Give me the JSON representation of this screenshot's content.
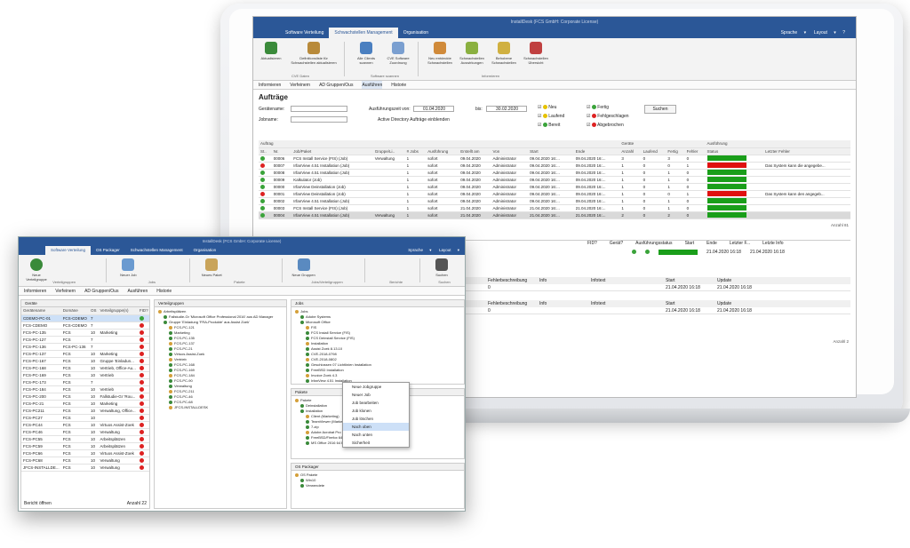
{
  "laptop": {
    "title": "InstallDesk (FCS GmbH: Corporate License)",
    "tabs": [
      "Software Verteilung",
      "Schwachstellen Management",
      "Organisation"
    ],
    "active_tab": "Schwachstellen Management",
    "menu_right": [
      "Sprache",
      "Layout"
    ],
    "ribbon": [
      {
        "label": "Aktualisieren"
      },
      {
        "label": "Definitionsliste für Schwachstellen aktualisieren"
      },
      {
        "label": "Alle Clients scannen"
      },
      {
        "label": "CVE Software Zuordnung"
      },
      {
        "label": "Neu entdeckte Schwachstellen"
      },
      {
        "label": "Schwachstellen Auswirkungen"
      },
      {
        "label": "Behobene Schwachstellen"
      },
      {
        "label": "Schwachstellen Übersicht"
      }
    ],
    "ribbon_groups": [
      "CVE Daten",
      "Software scannen",
      "Informieren"
    ],
    "nav_tabs": [
      "Informieren",
      "Verfeinern",
      "AD Gruppen/Ous",
      "Ausführen",
      "Historie"
    ],
    "section": "Aufträge",
    "filters": {
      "ger_label": "Gerätename:",
      "job_label": "Jobname:",
      "date_label": "Ausführungszeit von:",
      "date_from": "01.04.2020",
      "bis": "bis:",
      "date_to": "30.02.2020",
      "ad": "Active Directory Aufträge einblenden",
      "search": "Suchen"
    },
    "status_checks": [
      "Neu",
      "Laufend",
      "Bereit",
      "Fertig",
      "Fehlgeschlagen",
      "Abgebrochen"
    ],
    "group_headers": [
      "Auftrag",
      "Geräte",
      "Ausführung"
    ],
    "columns": [
      "St..",
      "Nr.",
      "Job/Paket",
      "Gruppe/Li..",
      "# Jobs",
      "Ausführung",
      "Erstellt am",
      "Von",
      "Start",
      "Ende",
      "Anzahl",
      "Laufend",
      "Fertig",
      "Fehler",
      "Status",
      "Letzter Fehler"
    ],
    "rows": [
      {
        "st": "ok",
        "nr": "00006",
        "job": "FCS Install Service (FIS) (Job)",
        "grp": "Verwaltung",
        "n": "1",
        "ex": "sofort",
        "cr": "09.04.2020",
        "von": "Administrator",
        "start": "09.04.2020 16:...",
        "end": "09.04.2020 16:...",
        "cnt": "3",
        "run": "0",
        "done": "3",
        "fail": "0",
        "bar": "g",
        "err": ""
      },
      {
        "st": "err",
        "nr": "00007",
        "job": "IrfanView 4.51 Installation (Job)",
        "grp": "",
        "n": "1",
        "ex": "sofort",
        "cr": "09.04.2020",
        "von": "Administrator",
        "start": "09.04.2020 16:...",
        "end": "09.04.2020 16:...",
        "cnt": "1",
        "run": "0",
        "done": "0",
        "fail": "1",
        "bar": "r",
        "err": "Das System kann die angegebe..."
      },
      {
        "st": "ok",
        "nr": "00008",
        "job": "IrfanView 4.51 Installation (Job)",
        "grp": "",
        "n": "1",
        "ex": "sofort",
        "cr": "09.04.2020",
        "von": "Administrator",
        "start": "09.04.2020 16:...",
        "end": "09.04.2020 16:...",
        "cnt": "1",
        "run": "0",
        "done": "1",
        "fail": "0",
        "bar": "g",
        "err": ""
      },
      {
        "st": "ok",
        "nr": "00009",
        "job": "Kalkulator (Job)",
        "grp": "",
        "n": "1",
        "ex": "sofort",
        "cr": "09.04.2020",
        "von": "Administrator",
        "start": "09.04.2020 16:...",
        "end": "09.04.2020 16:...",
        "cnt": "1",
        "run": "0",
        "done": "1",
        "fail": "0",
        "bar": "g",
        "err": ""
      },
      {
        "st": "ok",
        "nr": "00000",
        "job": "IrfanView Deinstallation (Job)",
        "grp": "",
        "n": "1",
        "ex": "sofort",
        "cr": "09.04.2020",
        "von": "Administrator",
        "start": "09.04.2020 16:...",
        "end": "09.04.2020 16:...",
        "cnt": "1",
        "run": "0",
        "done": "1",
        "fail": "0",
        "bar": "g",
        "err": ""
      },
      {
        "st": "err",
        "nr": "00001",
        "job": "IrfanView Deinstallation (Job)",
        "grp": "",
        "n": "1",
        "ex": "sofort",
        "cr": "09.04.2020",
        "von": "Administrator",
        "start": "09.04.2020 16:...",
        "end": "09.04.2020 16:...",
        "cnt": "1",
        "run": "0",
        "done": "0",
        "fail": "1",
        "bar": "r",
        "err": "Das System kann den angegeb..."
      },
      {
        "st": "ok",
        "nr": "00002",
        "job": "IrfanView 4.51 Installation (Job)",
        "grp": "",
        "n": "1",
        "ex": "sofort",
        "cr": "09.04.2020",
        "von": "Administrator",
        "start": "09.04.2020 16:...",
        "end": "09.04.2020 16:...",
        "cnt": "1",
        "run": "0",
        "done": "1",
        "fail": "0",
        "bar": "g",
        "err": ""
      },
      {
        "st": "ok",
        "nr": "00003",
        "job": "FCS Install Service (FIS) (Job)",
        "grp": "",
        "n": "1",
        "ex": "sofort",
        "cr": "21.04.2020",
        "von": "Administrator",
        "start": "21.04.2020 16:...",
        "end": "21.04.2020 16:...",
        "cnt": "1",
        "run": "0",
        "done": "1",
        "fail": "0",
        "bar": "g",
        "err": ""
      },
      {
        "st": "ok",
        "nr": "00004",
        "job": "IrfanView 4.51 Installation (Job)",
        "grp": "Verwaltung",
        "n": "1",
        "ex": "sofort",
        "cr": "21.04.2020",
        "von": "Administrator",
        "start": "21.04.2020 16:...",
        "end": "21.04.2020 16:...",
        "cnt": "2",
        "run": "0",
        "done": "2",
        "fail": "0",
        "bar": "g",
        "err": ""
      }
    ],
    "count1": "Anzahl 81",
    "count2": "Anzahl 2",
    "detail_cols": [
      "FID?",
      "Gerät?",
      "Ausführungsstatus",
      "Start",
      "Ende",
      "Letzter F...",
      "Letzte Info"
    ],
    "detail_row": {
      "start": "21.04.2020 16:18",
      "end": "21.04.2020 16:18"
    },
    "sub_cols": [
      "Fehler",
      "Fehlerbeschreibung",
      "Info",
      "Infotext",
      "Start",
      "Update"
    ],
    "sub_rows": [
      {
        "status": "Fertig",
        "fehler": "0",
        "start": "21.04.2020 16:18",
        "update": "21.04.2020 16:18"
      },
      {
        "status": "Fertig",
        "fehler": "0",
        "start": "21.04.2020 16:18",
        "update": "21.04.2020 16:18"
      }
    ]
  },
  "win2": {
    "title": "InstallDesk (FCS GmbH: Corporate License)",
    "tabs": [
      "Software Verteilung",
      "OS Packager",
      "Schwachstellen Management",
      "Organisation"
    ],
    "active_tab": "Software Verteilung",
    "menu_right": [
      "Sprache",
      "Layout"
    ],
    "ribbon_groups": [
      "Verteilgruppen",
      "Jobs",
      "Pakete",
      "Jobs/Verteilgruppen",
      "Berichte",
      "Suchen"
    ],
    "ribbon_btns": [
      "Neue Verteilgruppe",
      "Neuer Job",
      "Neues Paket",
      "Neue Gruppen",
      "Suchen"
    ],
    "nav_tabs": [
      "Informieren",
      "Verfeinern",
      "AD Gruppen/Ous",
      "Ausführen",
      "Historie"
    ],
    "panels": {
      "devices": "Geräte",
      "groups": "Verteilgruppen",
      "jobs": "Jobs",
      "packages": "Pakete",
      "os": "OS Packager"
    },
    "dev_cols": [
      "Gerätename",
      "Domäne",
      "OS",
      "Verteilgruppe(n)",
      "FID?"
    ],
    "devices": [
      {
        "n": "CDEMO-PC-01",
        "d": "FCS-CDEMO",
        "os": "7",
        "g": "",
        "s": "ok"
      },
      {
        "n": "FCS-CDEMO",
        "d": "FCS-CDEMO",
        "os": "7",
        "g": "",
        "s": "err"
      },
      {
        "n": "FCS-PC-135",
        "d": "FCS",
        "os": "10",
        "g": "Marketing",
        "s": "err"
      },
      {
        "n": "FCS-PC-127",
        "d": "FCS",
        "os": "7",
        "g": "",
        "s": "err"
      },
      {
        "n": "FCS-PC-136",
        "d": "FCS-PC-136",
        "os": "7",
        "g": "",
        "s": "err"
      },
      {
        "n": "FCS-PC-137",
        "d": "FCS",
        "os": "10",
        "g": "Marketing",
        "s": "err"
      },
      {
        "n": "FCS-PC-167",
        "d": "FCS",
        "os": "10",
        "g": "Gruppe 'Einladun...",
        "s": "err"
      },
      {
        "n": "FCS-PC-168",
        "d": "FCS",
        "os": "10",
        "g": "Vertrieb, Office-Au...",
        "s": "err"
      },
      {
        "n": "FCS-PC-169",
        "d": "FCS",
        "os": "10",
        "g": "Vertrieb",
        "s": "err"
      },
      {
        "n": "FCS-PC-173",
        "d": "FCS",
        "os": "7",
        "g": "",
        "s": "err"
      },
      {
        "n": "FCS-PC-184",
        "d": "FCS",
        "os": "10",
        "g": "Vertrieb",
        "s": "err"
      },
      {
        "n": "FCS-PC-200",
        "d": "FCS",
        "os": "10",
        "g": "Fallstudie-Gr 'Rou...",
        "s": "err"
      },
      {
        "n": "FCS-PC-21",
        "d": "FCS",
        "os": "10",
        "g": "Marketing",
        "s": "err"
      },
      {
        "n": "FCS-PC211",
        "d": "FCS",
        "os": "10",
        "g": "Verwaltung, Office...",
        "s": "err"
      },
      {
        "n": "FCS-PC27",
        "d": "FCS",
        "os": "10",
        "g": "",
        "s": "err"
      },
      {
        "n": "FCS-PC44",
        "d": "FCS",
        "os": "10",
        "g": "Virtuos Assist-Zoek",
        "s": "err"
      },
      {
        "n": "FCS-PC46",
        "d": "FCS",
        "os": "10",
        "g": "Verwaltung",
        "s": "err"
      },
      {
        "n": "FCS-PC55",
        "d": "FCS",
        "os": "10",
        "g": "Arbeitsplätzen",
        "s": "err"
      },
      {
        "n": "FCS-PC59",
        "d": "FCS",
        "os": "10",
        "g": "Arbeitsplätzen",
        "s": "err"
      },
      {
        "n": "FCS-PC66",
        "d": "FCS",
        "os": "10",
        "g": "Virtuos Assist-Zoek",
        "s": "err"
      },
      {
        "n": "FCS-PC68",
        "d": "FCS",
        "os": "10",
        "g": "Verwaltung",
        "s": "err"
      },
      {
        "n": "JFCS-INSTALLDE...",
        "d": "FCS",
        "os": "10",
        "g": "Verwaltung",
        "s": "err"
      }
    ],
    "dev_footer": "Bericht öffnen",
    "dev_count": "Anzahl 22",
    "group_tree": [
      "Arbeitsplätzen",
      "Fallstudie-Gr 'Microsoft Office Professional 2016' aus AD Manager",
      "Gruppe 'Einladung 'FRA-Produkte' aus Assist Zoek'",
      "FCS-PC-121",
      "Marketing",
      "FCS-PC-135",
      "FCS-PC-137",
      "FCS-PC-21",
      "Virtuos Assist-Zoek",
      "Vertrieb",
      "FCS-PC-168",
      "FCS-PC-169",
      "FCS-PC-184",
      "FCS-PC-90",
      "Verwaltung",
      "FCS-PC-211",
      "FCS-PC-46",
      "FCS-PC-68",
      "JFCS-INSTALLDESK"
    ],
    "job_tree": [
      "Jobs",
      "Adobe Systems",
      "Microsoft Office",
      "FIS",
      "FCS Install Service (FIS)",
      "FCS Deinstall Service (FIS)",
      "Installation",
      "Assist Zoek 8.13.10",
      "CVE-2018-0798",
      "CVE-2018-0802",
      "Geschlossen 07 Lichtlinien Installation",
      "FreeBSD Installation",
      "Invoice Zoek 4.3",
      "IrfanView 4.51 Installation",
      "IrfanView Plugins 4.51 Installation"
    ],
    "pkg_tree": [
      "Pakete",
      "Deinstallation",
      "Installation",
      "Client (Marketing)",
      "TeamViewer (Marketing)",
      "7-zip",
      "Adobe Acrobat Pro",
      "FreeBSD/Firefox 64",
      "MS Office 2016 64 Bit"
    ],
    "os_tree": [
      "OS Pakete",
      "Win10",
      "Verwendete"
    ],
    "context_menu": [
      "Neue Jobgruppe",
      "Neuer Job",
      "Job bearbeiten",
      "Job klonen",
      "Job löschen",
      "Nach oben",
      "Nach unten",
      "Sicherheit"
    ],
    "context_selected": "Nach oben"
  },
  "colors": {
    "titlebar": "#2b5797",
    "ok": "#3aa33a",
    "err": "#d22",
    "bar_ok": "#1a9e1a",
    "bar_err": "#e01010"
  }
}
